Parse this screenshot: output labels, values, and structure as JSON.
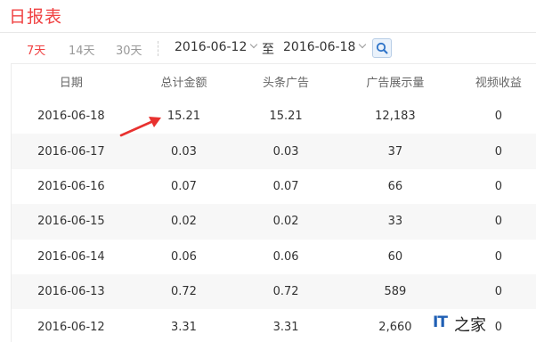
{
  "page": {
    "title": "日报表"
  },
  "filters": {
    "ranges": [
      "7天",
      "14天",
      "30天"
    ],
    "active_range": "7天",
    "start_date": "2016-06-12",
    "end_date": "2016-06-18",
    "to_label": "至"
  },
  "table": {
    "headers": [
      "日期",
      "总计金额",
      "头条广告",
      "广告展示量",
      "视频收益"
    ],
    "rows": [
      [
        "2016-06-18",
        "15.21",
        "15.21",
        "12,183",
        "0"
      ],
      [
        "2016-06-17",
        "0.03",
        "0.03",
        "37",
        "0"
      ],
      [
        "2016-06-16",
        "0.07",
        "0.07",
        "66",
        "0"
      ],
      [
        "2016-06-15",
        "0.02",
        "0.02",
        "33",
        "0"
      ],
      [
        "2016-06-14",
        "0.06",
        "0.06",
        "60",
        "0"
      ],
      [
        "2016-06-13",
        "0.72",
        "0.72",
        "589",
        "0"
      ],
      [
        "2016-06-12",
        "3.31",
        "3.31",
        "2,660",
        "0"
      ]
    ]
  },
  "watermark": {
    "logo": "IT",
    "text": "之家"
  },
  "colors": {
    "accent": "#f04142",
    "search_icon": "#2d73c8"
  },
  "icons": {
    "search": "magnifier-icon",
    "dropdown": "chevron-down-icon",
    "annotation": "red-arrow-icon"
  }
}
